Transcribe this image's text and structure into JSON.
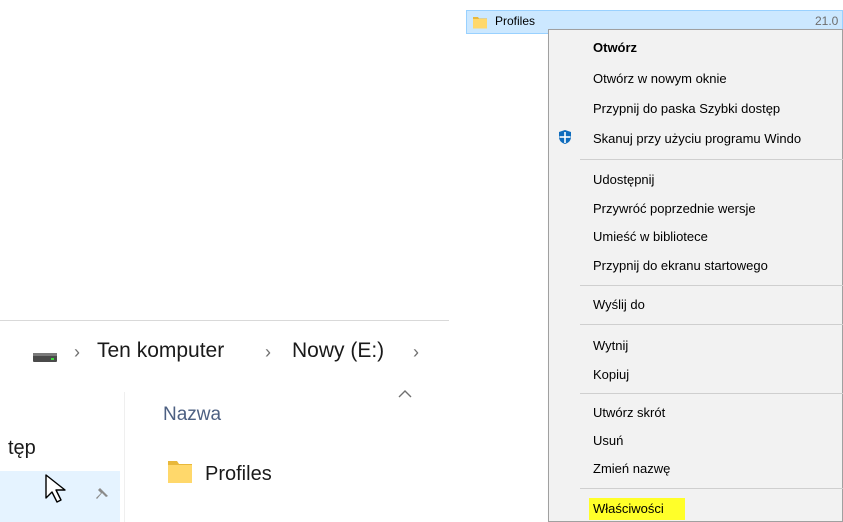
{
  "top_item": {
    "name": "Profiles",
    "date": "21.0"
  },
  "context_menu": {
    "items": [
      {
        "label": "Otwórz",
        "bold": true
      },
      {
        "label": "Otwórz w nowym oknie"
      },
      {
        "label": "Przypnij do paska Szybki dostęp"
      },
      {
        "label": "Skanuj przy użyciu programu Windo",
        "icon": "windows-defender-shield-icon"
      },
      {
        "label": "Udostępnij"
      },
      {
        "label": "Przywróć poprzednie wersje"
      },
      {
        "label": "Umieść w bibliotece"
      },
      {
        "label": "Przypnij do ekranu startowego"
      },
      {
        "label": "Wyślij do"
      },
      {
        "label": "Wytnij"
      },
      {
        "label": "Kopiuj"
      },
      {
        "label": "Utwórz skrót"
      },
      {
        "label": "Usuń"
      },
      {
        "label": "Zmień nazwę"
      },
      {
        "label": "Właściwości",
        "highlighted": true,
        "highlight_color": "#ffff29"
      }
    ]
  },
  "breadcrumb": {
    "drive_icon": "drive-icon",
    "items": [
      "Ten komputer",
      "Nowy (E:)"
    ],
    "separator": "›"
  },
  "nav": {
    "partial_label": "tęp"
  },
  "file_list": {
    "column_header": "Nazwa",
    "items": [
      {
        "name": "Profiles",
        "icon": "folder-icon"
      }
    ]
  },
  "colors": {
    "folder": "#ffd86b",
    "selection": "#cce8ff",
    "column_header": "#4d6082"
  }
}
